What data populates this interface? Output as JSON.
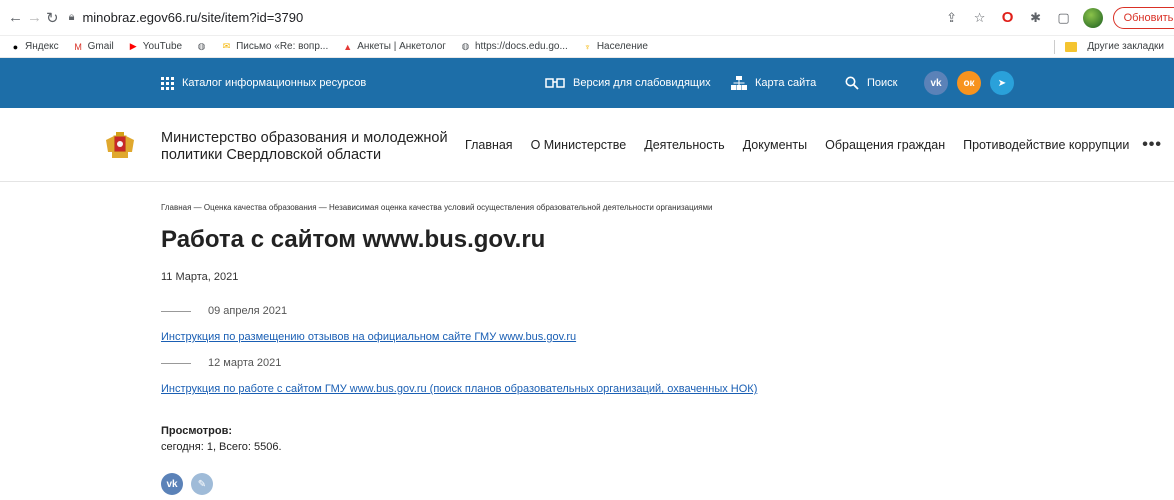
{
  "browser": {
    "url": "minobraz.egov66.ru/site/item?id=3790",
    "update_label": "Обновить",
    "icons": [
      "back-icon",
      "forward-icon",
      "reload-icon",
      "lock-icon",
      "share-icon",
      "star-icon",
      "opera-icon",
      "extensions-icon",
      "sidebar-icon",
      "profile-avatar",
      "more-icon"
    ]
  },
  "bookmarks": {
    "items": [
      {
        "label": "Яндекс",
        "icon": "yandex-icon",
        "color": "#000000"
      },
      {
        "label": "Gmail",
        "icon": "gmail-icon",
        "color": "#d93025"
      },
      {
        "label": "YouTube",
        "icon": "youtube-icon",
        "color": "#ff0000"
      },
      {
        "label": "",
        "icon": "globe-icon",
        "color": "#5f6368"
      },
      {
        "label": "Письмо «Re: вопр...",
        "icon": "mail-icon",
        "color": "#f4b400"
      },
      {
        "label": "Анкеты | Анкетолог",
        "icon": "anketolog-icon",
        "color": "#e53935"
      },
      {
        "label": "https://docs.edu.go...",
        "icon": "globe-icon",
        "color": "#5f6368"
      },
      {
        "label": "Население",
        "icon": "population-icon",
        "color": "#f4b400"
      }
    ],
    "other_label": "Другие закладки"
  },
  "site_header": {
    "catalog_label": "Каталог информационных ресурсов",
    "vision_label": "Версия для слабовидящих",
    "sitemap_label": "Карта сайта",
    "search_label": "Поиск",
    "social": [
      {
        "name": "vk",
        "text": "vk",
        "color": "#5b82b8"
      },
      {
        "name": "ok",
        "text": "ок",
        "color": "#f7931e"
      },
      {
        "name": "telegram",
        "text": "➤",
        "color": "#2aa1da"
      }
    ],
    "bg_color": "#1d6ea8"
  },
  "site_nav": {
    "org_name_line1": "Министерство образования и молодежной",
    "org_name_line2": "политики Свердловской области",
    "links": [
      "Главная",
      "О Министерстве",
      "Деятельность",
      "Документы",
      "Обращения граждан",
      "Противодействие коррупции"
    ],
    "more": "•••"
  },
  "content": {
    "breadcrumb": "Главная  —  Оценка качества образования  —  Независимая оценка качества условий осуществления образовательной деятельности организациями",
    "title": "Работа с сайтом www.bus.gov.ru",
    "date": "11 Марта, 2021",
    "entries": [
      {
        "date": "09 апреля 2021",
        "link": "Инструкция по размещению отзывов на официальном сайте ГМУ www.bus.gov.ru"
      },
      {
        "date": "12 марта 2021",
        "link": "Инструкция по работе с сайтом ГМУ www.bus.gov.ru (поиск планов образовательных организаций, охваченных НОК)"
      }
    ],
    "views_label": "Просмотров:",
    "views_value": "сегодня: 1, Всего: 5506.",
    "share": [
      {
        "name": "vk",
        "text": "vk",
        "color": "#5b82b8"
      },
      {
        "name": "link",
        "text": "✎",
        "color": "#9fbbd8"
      }
    ]
  }
}
